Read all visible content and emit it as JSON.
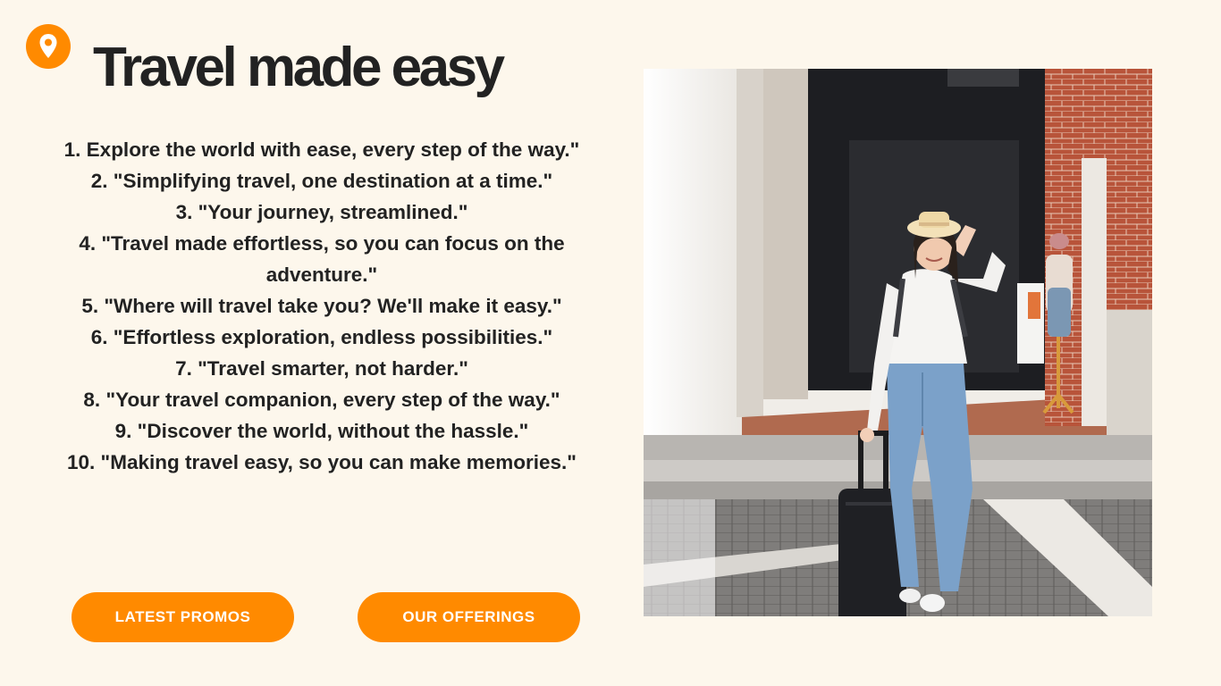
{
  "header": {
    "icon": "map-pin-icon",
    "title": "Travel made easy"
  },
  "slogans": [
    "1. Explore the world with ease, every step of the way.\"",
    "2. \"Simplifying travel, one destination at a time.\"",
    "3. \"Your journey, streamlined.\"",
    "4. \"Travel made effortless, so you can focus on the adventure.\"",
    "5. \"Where will travel take you? We'll make it easy.\"",
    "6. \"Effortless exploration, endless possibilities.\"",
    "7. \"Travel smarter, not harder.\"",
    "8. \"Your travel companion, every step of the way.\"",
    "9. \"Discover the world, without the hassle.\"",
    "10. \"Making travel easy, so you can make memories.\""
  ],
  "buttons": {
    "promos": "LATEST PROMOS",
    "offerings": "OUR OFFERINGS"
  },
  "colors": {
    "background": "#fdf7ec",
    "accent": "#ff8a00",
    "text": "#222222"
  }
}
